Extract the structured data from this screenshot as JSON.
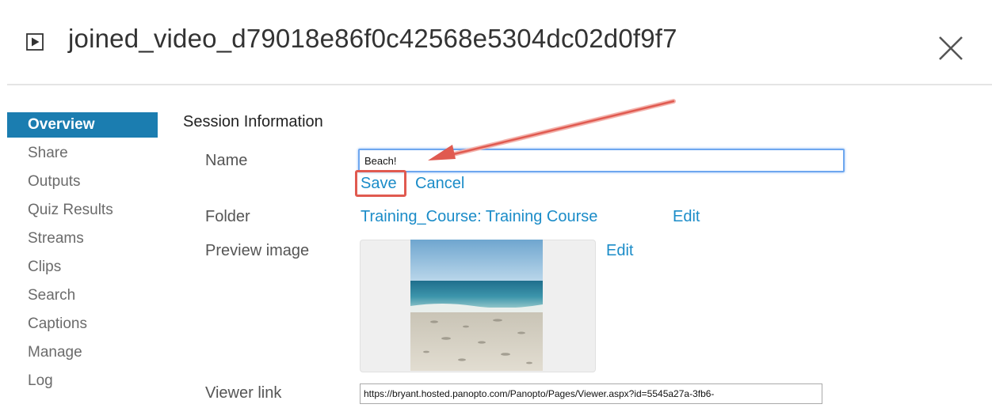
{
  "header": {
    "title": "joined_video_d79018e86f0c42568e5304dc02d0f9f7",
    "title_icon": "play-square-icon",
    "close_icon": "close-x-icon"
  },
  "sidebar": {
    "items": [
      {
        "label": "Overview",
        "active": true
      },
      {
        "label": "Share"
      },
      {
        "label": "Outputs"
      },
      {
        "label": "Quiz Results"
      },
      {
        "label": "Streams"
      },
      {
        "label": "Clips"
      },
      {
        "label": "Search"
      },
      {
        "label": "Captions"
      },
      {
        "label": "Manage"
      },
      {
        "label": "Log"
      }
    ]
  },
  "main": {
    "section_title": "Session Information",
    "name": {
      "label": "Name",
      "value": "Beach!",
      "save_label": "Save",
      "cancel_label": "Cancel"
    },
    "folder": {
      "label": "Folder",
      "value": "Training_Course: Training Course",
      "edit_label": "Edit"
    },
    "preview": {
      "label": "Preview image",
      "edit_label": "Edit"
    },
    "viewer_link": {
      "label": "Viewer link",
      "value": "https://bryant.hosted.panopto.com/Panopto/Pages/Viewer.aspx?id=5545a27a-3fb6-"
    }
  },
  "colors": {
    "accent": "#1b7db0",
    "link": "#1b8cc8",
    "annotation": "#e05a50",
    "focus_border": "#6ea7ef"
  }
}
